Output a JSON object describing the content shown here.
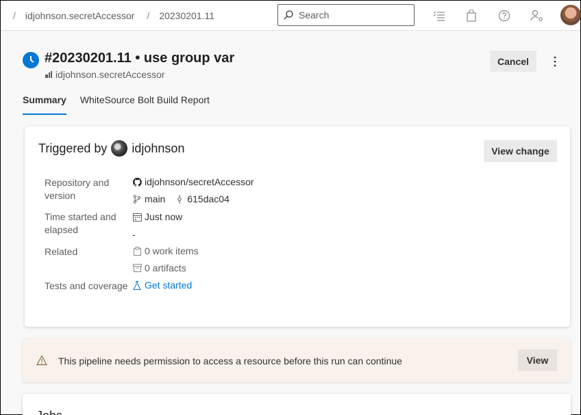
{
  "breadcrumb": {
    "separator": "/",
    "pipeline": "idjohnson.secretAccessor",
    "run": "20230201.11"
  },
  "search": {
    "placeholder": "Search"
  },
  "run": {
    "title": "#20230201.11 • use group var",
    "pipeline": "idjohnson.secretAccessor",
    "cancel_label": "Cancel",
    "status": "running"
  },
  "tabs": [
    {
      "label": "Summary",
      "active": true
    },
    {
      "label": "WhiteSource Bolt Build Report",
      "active": false
    }
  ],
  "summary": {
    "triggered_by_label": "Triggered by",
    "triggered_by_user": "idjohnson",
    "view_change_label": "View change",
    "repo_label": "Repository and version",
    "repo_name": "idjohnson/secretAccessor",
    "branch": "main",
    "commit": "615dac04",
    "time_label": "Time started and elapsed",
    "time_started": "Just now",
    "elapsed": "-",
    "related_label": "Related",
    "work_items": "0 work items",
    "artifacts": "0 artifacts",
    "tests_label": "Tests and coverage",
    "tests_link": "Get started"
  },
  "banner": {
    "message": "This pipeline needs permission to access a resource before this run can continue",
    "view_label": "View"
  },
  "jobs": {
    "title": "Jobs"
  },
  "colors": {
    "accent": "#0078d4",
    "warning_bg": "#f9f1ec",
    "warning_icon": "#8a6d3b"
  }
}
